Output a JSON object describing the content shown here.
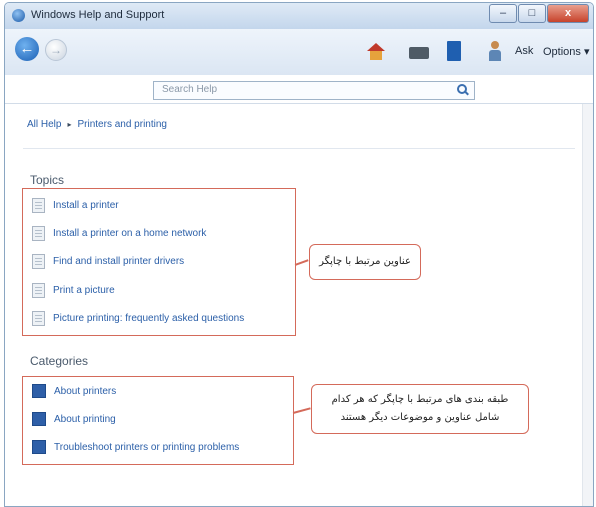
{
  "window": {
    "title": "Windows Help and Support",
    "controls": [
      "–",
      "□",
      "x"
    ]
  },
  "toolbar": {
    "ask_label": "Ask",
    "options_label": "Options ▾",
    "back_glyph": "←",
    "forward_glyph": "→"
  },
  "search": {
    "placeholder": "Search Help"
  },
  "breadcrumb": {
    "items": [
      "All Help",
      "Printers and printing"
    ],
    "separator": "▸"
  },
  "topics": {
    "heading": "Topics",
    "items": [
      "Install a printer",
      "Install a printer on a home network",
      "Find and install printer drivers",
      "Print a picture",
      "Picture printing: frequently asked questions"
    ]
  },
  "categories": {
    "heading": "Categories",
    "items": [
      "About printers",
      "About printing",
      "Troubleshoot printers or printing problems"
    ]
  },
  "annotations": {
    "topics_callout": "عناوین مرتبط با چاپگر",
    "categories_callout_line1": "طبقه بندی های مرتبط با چاپگر که هر کدام",
    "categories_callout_line2": "شامل عناوین و موضوعات دیگر هستند"
  },
  "colors": {
    "link": "#2b5fa8",
    "annotation_border": "#d46a5a",
    "heading": "#4a5a6c"
  }
}
